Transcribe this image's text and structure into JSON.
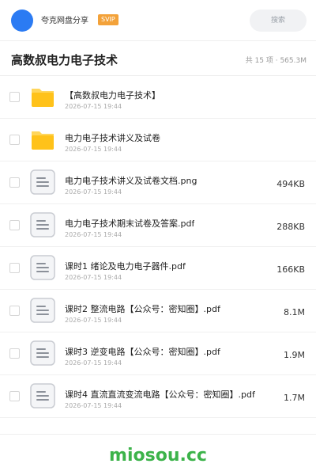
{
  "header": {
    "share_name": "夸克网盘分享",
    "badge": "SVIP",
    "search_placeholder": "搜索"
  },
  "folder": {
    "title": "高数叔电力电子技术",
    "meta": "共 15 项 · 565.3M"
  },
  "files": [
    {
      "type": "folder",
      "name": "【高数叔电力电子技术】",
      "date": "2026-07-15 19:44",
      "size": ""
    },
    {
      "type": "folder",
      "name": "电力电子技术讲义及试卷",
      "date": "2026-07-15 19:44",
      "size": ""
    },
    {
      "type": "doc",
      "name": "电力电子技术讲义及试卷文档.png",
      "date": "2026-07-15 19:44",
      "size": "494KB"
    },
    {
      "type": "doc",
      "name": "电力电子技术期末试卷及答案.pdf",
      "date": "2026-07-15 19:44",
      "size": "288KB"
    },
    {
      "type": "doc",
      "name": "课时1 绪论及电力电子器件.pdf",
      "date": "2026-07-15 19:44",
      "size": "166KB"
    },
    {
      "type": "doc",
      "name": "课时2 整流电路【公众号：密知圈】.pdf",
      "date": "2026-07-15 19:44",
      "size": "8.1M"
    },
    {
      "type": "doc",
      "name": "课时3 逆变电路【公众号：密知圈】.pdf",
      "date": "2026-07-15 19:44",
      "size": "1.9M"
    },
    {
      "type": "doc",
      "name": "课时4 直流直流变流电路【公众号：密知圈】.pdf",
      "date": "2026-07-15 19:44",
      "size": "1.7M"
    }
  ],
  "colors": {
    "accent": "#2b7bf3",
    "badge": "#f3a23a",
    "folder": "#ffc21a",
    "watermark": "#3cb34a"
  },
  "footer": {
    "watermark": "miosou.cc"
  }
}
